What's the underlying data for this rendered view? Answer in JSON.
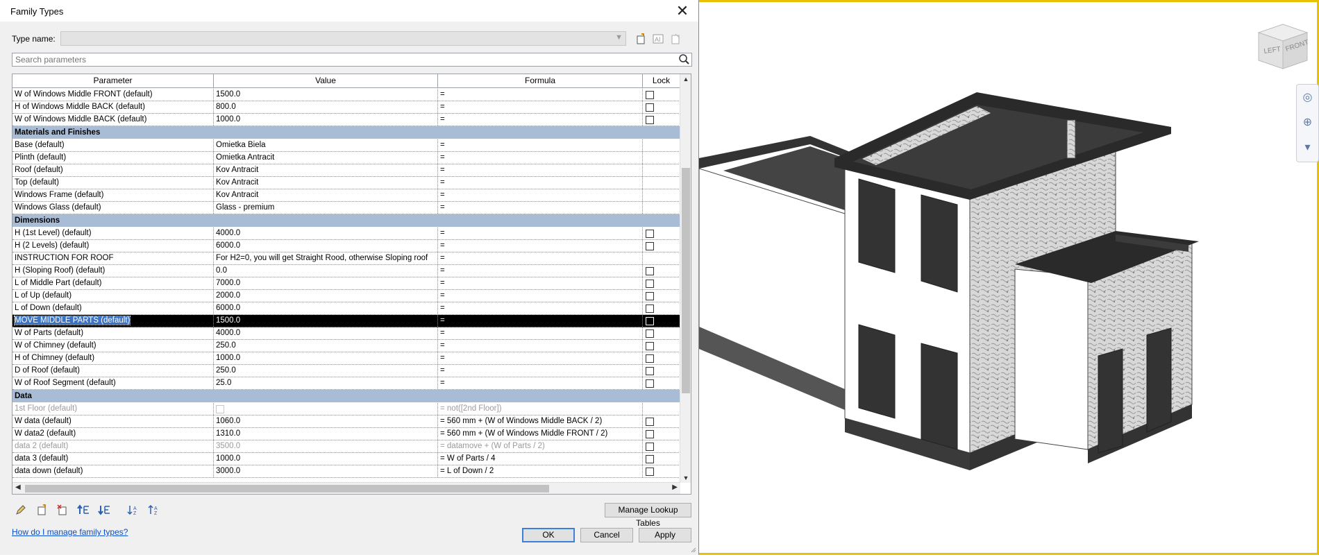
{
  "dialog": {
    "title": "Family Types",
    "type_name_label": "Type name:",
    "type_name_value": "",
    "search_placeholder": "Search parameters",
    "columns": [
      "Parameter",
      "Value",
      "Formula",
      "Lock"
    ],
    "help_link": "How do I manage family types?",
    "manage_lookup_label": "Manage Lookup Tables",
    "ok_label": "OK",
    "cancel_label": "Cancel",
    "apply_label": "Apply"
  },
  "rows": [
    {
      "type": "param",
      "param": "W of Windows Middle FRONT (default)",
      "value": "1500.0",
      "formula": "=",
      "lock": true
    },
    {
      "type": "param",
      "param": "H of Windows Middle BACK (default)",
      "value": "800.0",
      "formula": "=",
      "lock": true
    },
    {
      "type": "param",
      "param": "W of Windows Middle BACK (default)",
      "value": "1000.0",
      "formula": "=",
      "lock": true
    },
    {
      "type": "group",
      "label": "Materials and Finishes"
    },
    {
      "type": "param",
      "param": "Base (default)",
      "value": "Omietka Biela",
      "formula": "=",
      "lock": false
    },
    {
      "type": "param",
      "param": "Plinth (default)",
      "value": "Omietka Antracit",
      "formula": "=",
      "lock": false
    },
    {
      "type": "param",
      "param": "Roof (default)",
      "value": "Kov Antracit",
      "formula": "=",
      "lock": false
    },
    {
      "type": "param",
      "param": "Top (default)",
      "value": "Kov Antracit",
      "formula": "=",
      "lock": false
    },
    {
      "type": "param",
      "param": "Windows Frame (default)",
      "value": "Kov Antracit",
      "formula": "=",
      "lock": false
    },
    {
      "type": "param",
      "param": "Windows Glass (default)",
      "value": "Glass - premium",
      "formula": "=",
      "lock": false
    },
    {
      "type": "group",
      "label": "Dimensions"
    },
    {
      "type": "param",
      "param": "H (1st Level) (default)",
      "value": "4000.0",
      "formula": "=",
      "lock": true
    },
    {
      "type": "param",
      "param": "H (2 Levels) (default)",
      "value": "6000.0",
      "formula": "=",
      "lock": true
    },
    {
      "type": "param",
      "param": "INSTRUCTION FOR ROOF",
      "value": "For H2=0, you will get Straight Rood, otherwise Sloping roof",
      "formula": "=",
      "lock": false
    },
    {
      "type": "param",
      "param": "H (Sloping Roof) (default)",
      "value": "0.0",
      "formula": "=",
      "lock": true
    },
    {
      "type": "param",
      "param": "L of Middle Part (default)",
      "value": "7000.0",
      "formula": "=",
      "lock": true
    },
    {
      "type": "param",
      "param": "L of Up (default)",
      "value": "2000.0",
      "formula": "=",
      "lock": true
    },
    {
      "type": "param",
      "param": "L of Down (default)",
      "value": "6000.0",
      "formula": "=",
      "lock": true
    },
    {
      "type": "param",
      "param": "MOVE MIDDLE PARTS (default)",
      "value": "1500.0",
      "formula": "=",
      "lock": true,
      "selected": true
    },
    {
      "type": "param",
      "param": "W of Parts (default)",
      "value": "4000.0",
      "formula": "=",
      "lock": true
    },
    {
      "type": "param",
      "param": "W of Chimney (default)",
      "value": "250.0",
      "formula": "=",
      "lock": true
    },
    {
      "type": "param",
      "param": "H of Chimney (default)",
      "value": "1000.0",
      "formula": "=",
      "lock": true
    },
    {
      "type": "param",
      "param": "D of Roof (default)",
      "value": "250.0",
      "formula": "=",
      "lock": true
    },
    {
      "type": "param",
      "param": "W of Roof Segment (default)",
      "value": "25.0",
      "formula": "=",
      "lock": true
    },
    {
      "type": "group",
      "label": "Data"
    },
    {
      "type": "param",
      "param": "1st Floor (default)",
      "value": "",
      "value_checkbox": true,
      "formula": "= not([2nd Floor])",
      "lock": false,
      "disabled": true
    },
    {
      "type": "param",
      "param": "W data (default)",
      "value": "1060.0",
      "formula": "= 560 mm + (W of Windows Middle BACK / 2)",
      "lock": true
    },
    {
      "type": "param",
      "param": "W data2 (default)",
      "value": "1310.0",
      "formula": "= 560 mm + (W of Windows Middle FRONT / 2)",
      "lock": true
    },
    {
      "type": "param",
      "param": "data 2 (default)",
      "value": "3500.0",
      "formula": "= datamove + (W of Parts / 2)",
      "lock": true,
      "disabled": true
    },
    {
      "type": "param",
      "param": "data 3 (default)",
      "value": "1000.0",
      "formula": "= W of Parts / 4",
      "lock": true
    },
    {
      "type": "param",
      "param": "data down (default)",
      "value": "3000.0",
      "formula": "= L of Down / 2",
      "lock": true
    }
  ],
  "viewcube": {
    "left_label": "LEFT",
    "front_label": "FRONT"
  },
  "colors": {
    "group_bg": "#a9bcd6",
    "selection": "#000000",
    "viewport_border": "#e8c200"
  }
}
